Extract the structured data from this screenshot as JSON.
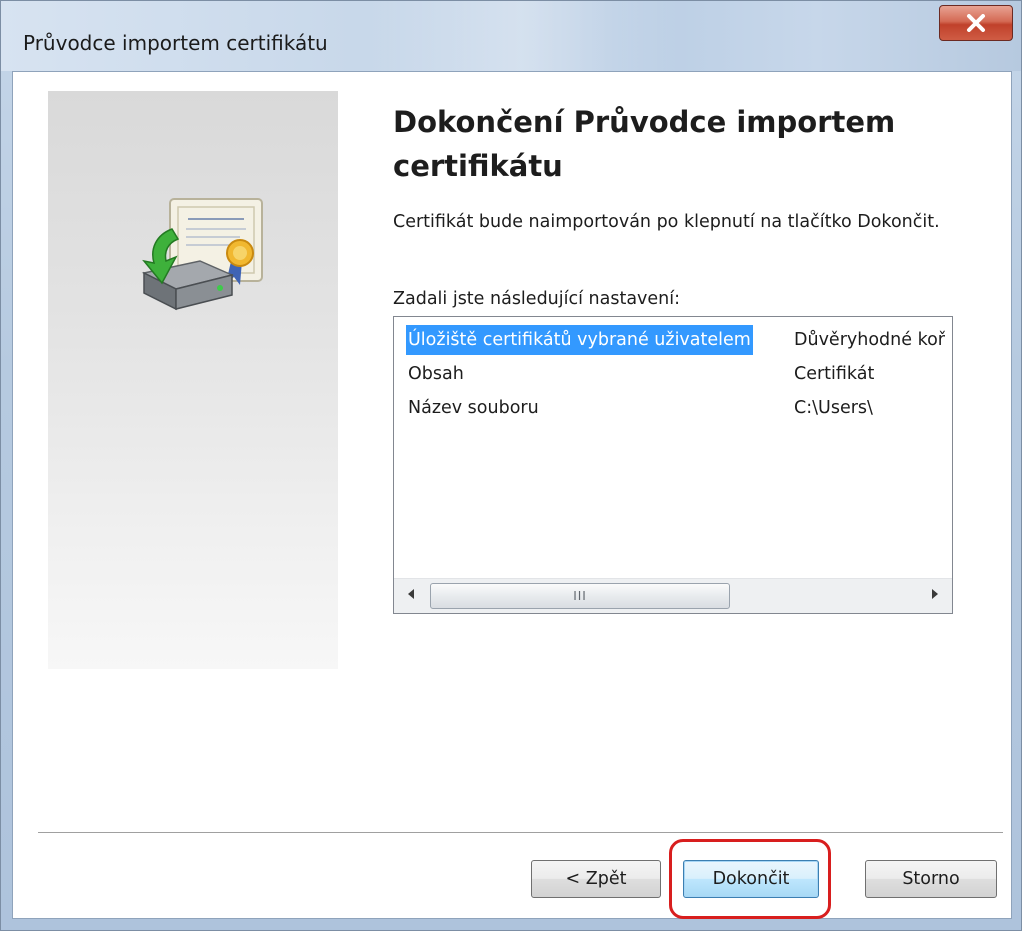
{
  "window": {
    "title": "Průvodce importem certifikátu"
  },
  "icons": {
    "close": "close-icon",
    "illustration": "certificate-import-icon",
    "scroll_left": "arrow-left-icon",
    "scroll_right": "arrow-right-icon",
    "scroll_grip": "grip-icon"
  },
  "main": {
    "heading": "Dokončení Průvodce importem certifikátu",
    "description": "Certifikát bude naimportován po klepnutí na tlačítko Dokončit.",
    "settings_label": "Zadali jste následující nastavení:",
    "settings": [
      {
        "key": "Úložiště certifikátů vybrané uživatelem",
        "value": "Důvěryhodné koř"
      },
      {
        "key": "Obsah",
        "value": "Certifikát"
      },
      {
        "key": "Název souboru",
        "value": "C:\\Users\\"
      }
    ],
    "scroll_grip_text": "III"
  },
  "buttons": {
    "back": "< Zpět",
    "finish": "Dokončit",
    "cancel": "Storno"
  },
  "colors": {
    "selection": "#3399ff",
    "highlight_ring": "#d81e1e",
    "close_button": "#c0412b"
  }
}
